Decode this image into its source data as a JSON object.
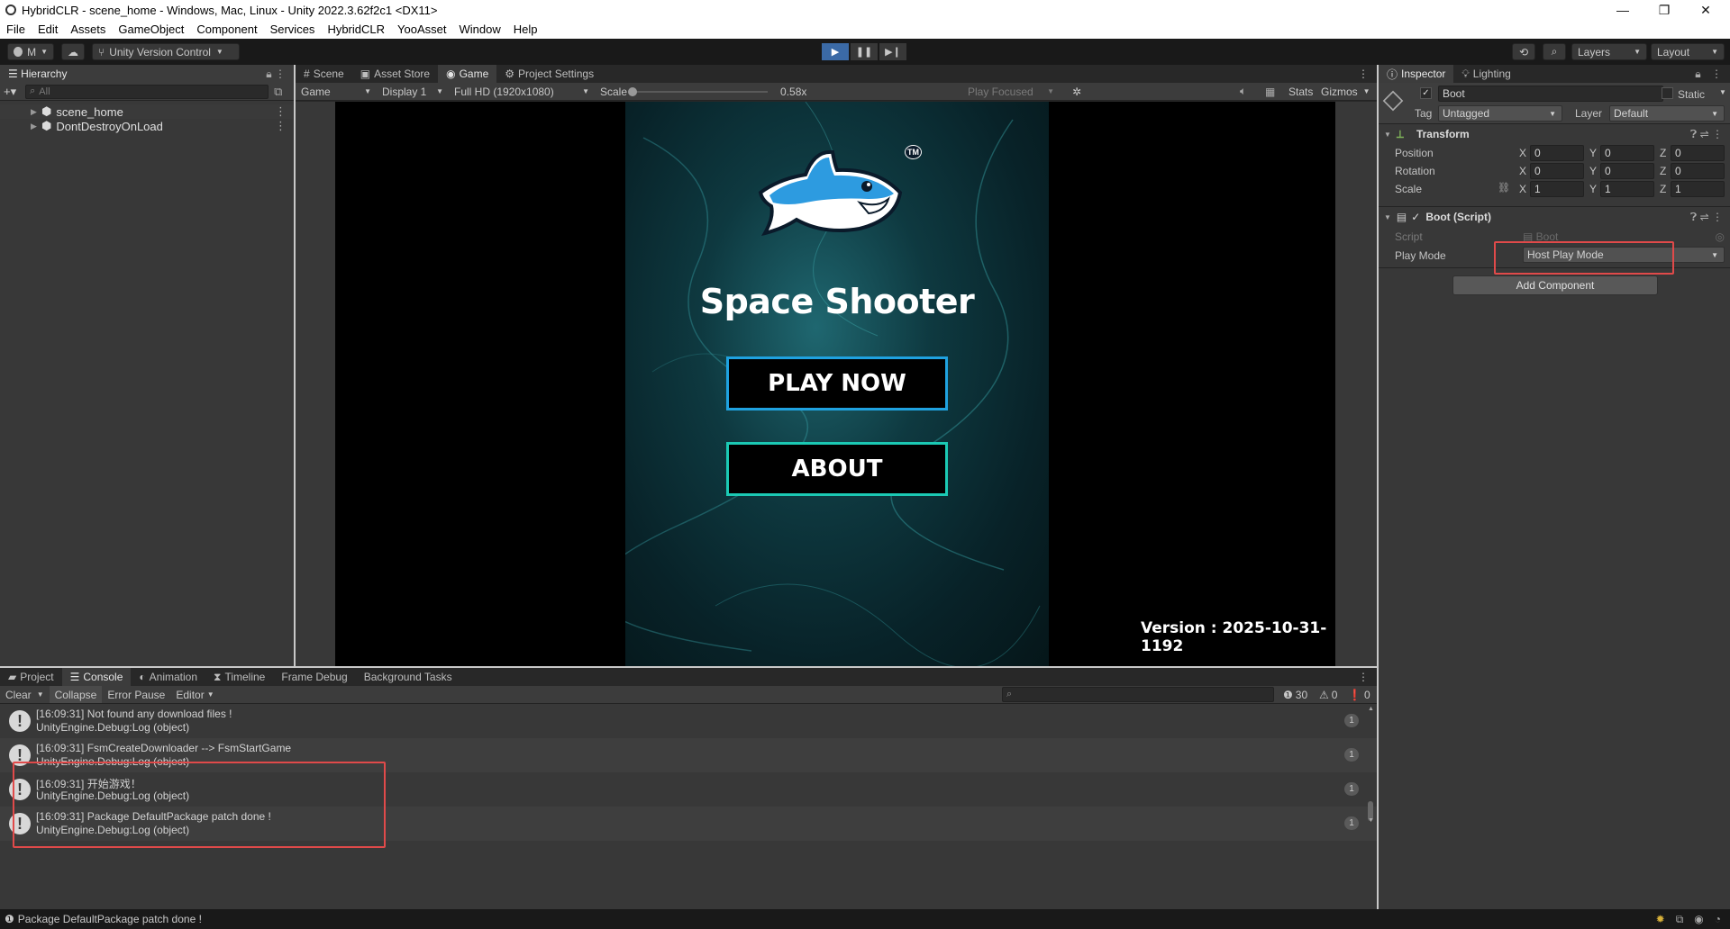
{
  "window": {
    "title": "HybridCLR - scene_home - Windows, Mac, Linux - Unity 2022.3.62f2c1 <DX11>",
    "controls": {
      "minimize": "—",
      "maximize": "❐",
      "close": "✕"
    }
  },
  "menu": [
    "File",
    "Edit",
    "Assets",
    "GameObject",
    "Component",
    "Services",
    "HybridCLR",
    "YooAsset",
    "Window",
    "Help"
  ],
  "toolbar": {
    "account": "M",
    "version_control": "Unity Version Control",
    "layers": "Layers",
    "layout": "Layout"
  },
  "hierarchy": {
    "tab": "Hierarchy",
    "search_placeholder": "All",
    "items": [
      "scene_home",
      "DontDestroyOnLoad"
    ]
  },
  "view_tabs": [
    "Scene",
    "Asset Store",
    "Game",
    "Project Settings"
  ],
  "game_bar": {
    "mode": "Game",
    "display": "Display 1",
    "resolution": "Full HD (1920x1080)",
    "scale_label": "Scale",
    "scale_value": "0.58x",
    "play_focused": "Play Focused",
    "stats": "Stats",
    "gizmos": "Gizmos",
    "scale_level": 0.0
  },
  "game": {
    "title": "Space Shooter",
    "play_button": "PLAY NOW",
    "about_button": "ABOUT",
    "version": "Version : 2025-10-31-1192",
    "logo_tm": "TM"
  },
  "inspector": {
    "tabs": [
      "Inspector",
      "Lighting"
    ],
    "object_name": "Boot",
    "static_label": "Static",
    "tag_label": "Tag",
    "tag_value": "Untagged",
    "layer_label": "Layer",
    "layer_value": "Default",
    "transform": {
      "title": "Transform",
      "rows": [
        {
          "label": "Position",
          "x": "0",
          "y": "0",
          "z": "0"
        },
        {
          "label": "Rotation",
          "x": "0",
          "y": "0",
          "z": "0"
        },
        {
          "label": "Scale",
          "x": "1",
          "y": "1",
          "z": "1"
        }
      ]
    },
    "boot_script": {
      "title": "Boot (Script)",
      "script_label": "Script",
      "script_value": "Boot",
      "play_mode_label": "Play Mode",
      "play_mode_value": "Host Play Mode"
    },
    "add_component": "Add Component"
  },
  "bottom_tabs": [
    "Project",
    "Console",
    "Animation",
    "Timeline",
    "Frame Debug",
    "Background Tasks"
  ],
  "console": {
    "clear": "Clear",
    "collapse": "Collapse",
    "error_pause": "Error Pause",
    "editor": "Editor",
    "count_log": "30",
    "count_warn": "0",
    "count_error": "0",
    "entries": [
      {
        "line1": "[16:09:31] Not found any download files !",
        "line2": "UnityEngine.Debug:Log (object)",
        "count": "1"
      },
      {
        "line1": "[16:09:31] FsmCreateDownloader --> FsmStartGame",
        "line2": "UnityEngine.Debug:Log (object)",
        "count": "1"
      },
      {
        "line1": "[16:09:31] 开始游戏！",
        "line2": "UnityEngine.Debug:Log (object)",
        "count": "1"
      },
      {
        "line1": "[16:09:31] Package DefaultPackage patch done !",
        "line2": "UnityEngine.Debug:Log (object)",
        "count": "1"
      }
    ]
  },
  "status_bar": "Package DefaultPackage patch done !",
  "colors": {
    "accent_play": "#4a78b5",
    "highlight_box": "#e04a4a",
    "button_blue_border": "#1fa2e0",
    "button_teal_border": "#1bc9b4"
  }
}
